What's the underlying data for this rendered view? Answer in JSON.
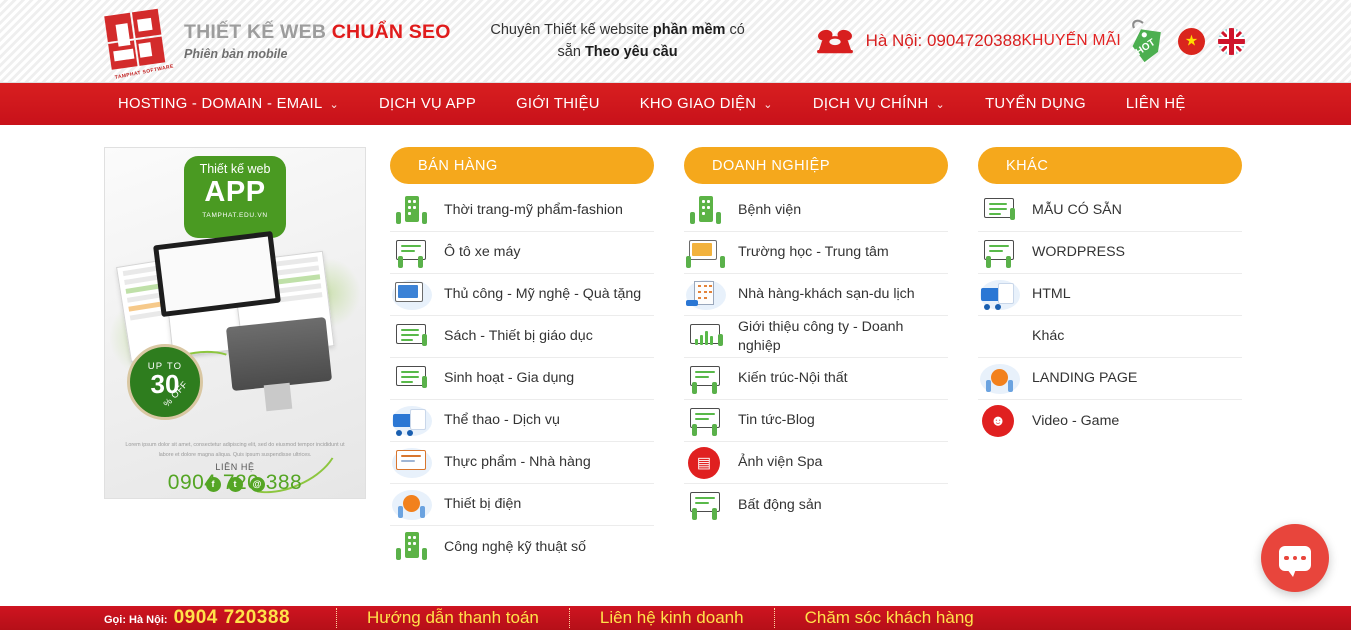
{
  "header": {
    "logo": {
      "line1_grey": "THIẾT KẾ WEB ",
      "line1_red": "CHUẨN SEO",
      "line2": "Phiên bản mobile",
      "mark_caption": "TAMPHAT SOFTWARE"
    },
    "tagline_part1": "Chuyên Thiết kế website ",
    "tagline_bold1": "phần mềm",
    "tagline_part2": " có sẵn ",
    "tagline_bold2": "Theo yêu cầu",
    "phone": "Hà Nội: 0904720388",
    "promo_label": "KHUYẾN MÃI",
    "promo_tag": "HOT",
    "flag_vn": "vietnam-flag",
    "flag_uk": "uk-flag"
  },
  "nav": {
    "items": [
      {
        "label": "HOSTING - DOMAIN - EMAIL",
        "caret": "⌄",
        "has_caret": true
      },
      {
        "label": "DỊCH VỤ APP",
        "caret": "",
        "has_caret": false
      },
      {
        "label": "GIỚI THIỆU",
        "caret": "",
        "has_caret": false
      },
      {
        "label": "KHO GIAO DIỆN",
        "caret": "⌄",
        "has_caret": true
      },
      {
        "label": "DỊCH VỤ CHÍNH",
        "caret": "⌄",
        "has_caret": true
      },
      {
        "label": "TUYỂN DỤNG",
        "caret": "",
        "has_caret": false
      },
      {
        "label": "LIÊN HỆ",
        "caret": "",
        "has_caret": false
      }
    ]
  },
  "banner": {
    "badge_line1": "Thiết kế web",
    "badge_line2": "APP",
    "badge_line3": "TAMPHAT.EDU.VN",
    "discount_top": "UP TO",
    "discount_value": "30",
    "discount_off": "% OFF",
    "lorem": "Lorem ipsum dolor sit amet, consectetur adipiscing elit, sed do eiusmod tempor incididunt ut labore et dolore magna aliqua. Quis ipsum suspendisse ultrices.",
    "contact_label": "LIÊN HỆ",
    "contact_phone": "0904 720 388",
    "socials": [
      "f",
      "t",
      "@"
    ]
  },
  "columns": [
    {
      "title": "BÁN HÀNG",
      "items": [
        {
          "label": "Thời trang-mỹ phẩm-fashion",
          "icon": "building-green-icon"
        },
        {
          "label": "Ô tô xe máy",
          "icon": "whiteboard-people-icon"
        },
        {
          "label": "Thủ công - Mỹ nghệ - Quà tặng",
          "icon": "laptop-blue-icon"
        },
        {
          "label": "Sách - Thiết bị giáo dục",
          "icon": "monitor-list-icon"
        },
        {
          "label": "Sinh hoạt - Gia dụng",
          "icon": "monitor-list-icon"
        },
        {
          "label": "Thể thao - Dịch vụ",
          "icon": "truck-blue-icon"
        },
        {
          "label": "Thực phẩm - Nhà hàng",
          "icon": "document-blue-icon"
        },
        {
          "label": "Thiết bị điện",
          "icon": "orange-bulb-icon"
        },
        {
          "label": "Công nghệ kỹ thuật số",
          "icon": "building-green-icon"
        }
      ]
    },
    {
      "title": "DOANH NGHIỆP",
      "items": [
        {
          "label": "Bệnh viện",
          "icon": "building-green-icon"
        },
        {
          "label": "Trường học - Trung tâm",
          "icon": "monitor-screen-icon"
        },
        {
          "label": "Nhà hàng-khách sạn-du lịch",
          "icon": "hotel-building-icon"
        },
        {
          "label": "Giới thiệu công ty - Doanh nghiệp",
          "icon": "chart-board-icon"
        },
        {
          "label": "Kiến trúc-Nội thất",
          "icon": "whiteboard-people-icon"
        },
        {
          "label": "Tin tức-Blog",
          "icon": "whiteboard-people-icon"
        },
        {
          "label": "Ảnh viện Spa",
          "icon": "red-clipboard-icon"
        },
        {
          "label": "Bất động sản",
          "icon": "whiteboard-people-icon"
        }
      ]
    },
    {
      "title": "KHÁC",
      "items": [
        {
          "label": "MẪU CÓ SẴN",
          "icon": "monitor-list-icon"
        },
        {
          "label": "WORDPRESS",
          "icon": "whiteboard-people-icon"
        },
        {
          "label": "HTML",
          "icon": "truck-blue-icon"
        },
        {
          "label": "Khác",
          "icon": ""
        },
        {
          "label": "LANDING PAGE",
          "icon": "orange-bulb-icon"
        },
        {
          "label": "Video - Game",
          "icon": "red-person-icon"
        }
      ]
    }
  ],
  "footer": {
    "call_label": "Gọi: Hà Nội:",
    "call_number": "0904 720388",
    "links": [
      "Hướng dẫn thanh toán",
      "Liên hệ kinh doanh",
      "Chăm sóc khách hàng"
    ]
  },
  "chat": {
    "name": "chat-widget-button"
  },
  "colors": {
    "brand_red": "#d81f20",
    "nav_red": "#c8111a",
    "accent_orange": "#f5a81c",
    "green": "#4a9a22",
    "footer_yellow": "#ffe24a"
  }
}
